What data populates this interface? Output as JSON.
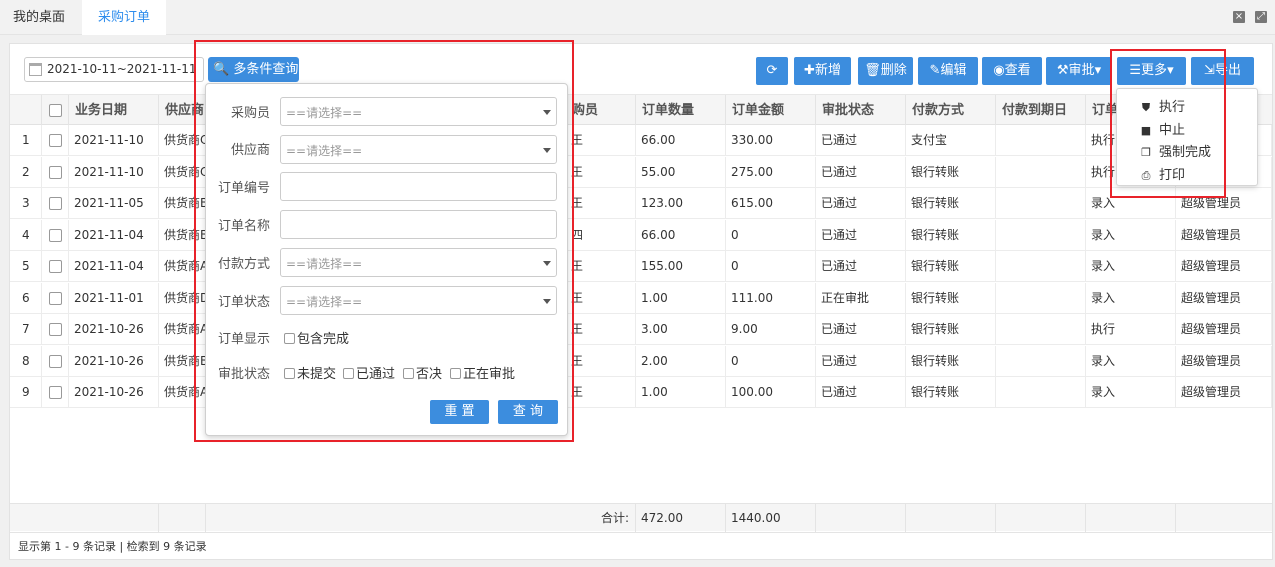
{
  "tabs": [
    {
      "label": "我的桌面"
    },
    {
      "label": "采购订单"
    }
  ],
  "toolbar": {
    "date_range": "2021-10-11~2021-11-11",
    "query_label": "多条件查询",
    "refresh_icon": "refresh-icon",
    "add_label": "新增",
    "delete_label": "删除",
    "edit_label": "编辑",
    "view_label": "查看",
    "approve_label": "审批",
    "more_label": "更多",
    "export_label": "导出"
  },
  "table": {
    "headers": [
      "业务日期",
      "供应商",
      "购员",
      "订单数量",
      "订单金额",
      "审批状态",
      "付款方式",
      "付款到期日",
      "订单"
    ],
    "rows": [
      {
        "no": "1",
        "date": "2021-11-10",
        "supplier": "供货商C",
        "buyer": "王",
        "qty": "66.00",
        "amount": "330.00",
        "approval": "已通过",
        "pay": "支付宝",
        "due": "",
        "status": "执行",
        "creator": ""
      },
      {
        "no": "2",
        "date": "2021-11-10",
        "supplier": "供货商C",
        "buyer": "王",
        "qty": "55.00",
        "amount": "275.00",
        "approval": "已通过",
        "pay": "银行转账",
        "due": "",
        "status": "执行",
        "creator": ""
      },
      {
        "no": "3",
        "date": "2021-11-05",
        "supplier": "供货商B",
        "buyer": "王",
        "qty": "123.00",
        "amount": "615.00",
        "approval": "已通过",
        "pay": "银行转账",
        "due": "",
        "status": "录入",
        "creator": "超级管理员"
      },
      {
        "no": "4",
        "date": "2021-11-04",
        "supplier": "供货商B",
        "buyer": "四",
        "qty": "66.00",
        "amount": "0",
        "approval": "已通过",
        "pay": "银行转账",
        "due": "",
        "status": "录入",
        "creator": "超级管理员"
      },
      {
        "no": "5",
        "date": "2021-11-04",
        "supplier": "供货商A",
        "buyer": "王",
        "qty": "155.00",
        "amount": "0",
        "approval": "已通过",
        "pay": "银行转账",
        "due": "",
        "status": "录入",
        "creator": "超级管理员"
      },
      {
        "no": "6",
        "date": "2021-11-01",
        "supplier": "供货商D",
        "buyer": "王",
        "qty": "1.00",
        "amount": "111.00",
        "approval": "正在审批",
        "pay": "银行转账",
        "due": "",
        "status": "录入",
        "creator": "超级管理员"
      },
      {
        "no": "7",
        "date": "2021-10-26",
        "supplier": "供货商A",
        "buyer": "王",
        "qty": "3.00",
        "amount": "9.00",
        "approval": "已通过",
        "pay": "银行转账",
        "due": "",
        "status": "执行",
        "creator": "超级管理员"
      },
      {
        "no": "8",
        "date": "2021-10-26",
        "supplier": "供货商B",
        "buyer": "王",
        "qty": "2.00",
        "amount": "0",
        "approval": "已通过",
        "pay": "银行转账",
        "due": "",
        "status": "录入",
        "creator": "超级管理员"
      },
      {
        "no": "9",
        "date": "2021-10-26",
        "supplier": "供货商A",
        "buyer": "王",
        "qty": "1.00",
        "amount": "100.00",
        "approval": "已通过",
        "pay": "银行转账",
        "due": "",
        "status": "录入",
        "creator": "超级管理员"
      }
    ],
    "total_label": "合计:",
    "total_qty": "472.00",
    "total_amount": "1440.00"
  },
  "pager": {
    "text": "显示第 1 - 9 条记录 | 检索到 9 条记录"
  },
  "query_panel": {
    "buyer_label": "采购员",
    "supplier_label": "供应商",
    "order_no_label": "订单编号",
    "order_name_label": "订单名称",
    "pay_method_label": "付款方式",
    "order_status_label": "订单状态",
    "order_display_label": "订单显示",
    "approval_status_label": "审批状态",
    "select_placeholder": "==请选择==",
    "include_done": "包含完成",
    "approval_options": [
      "未提交",
      "已通过",
      "否决",
      "正在审批"
    ],
    "reset_label": "重 置",
    "search_label": "查 询"
  },
  "more_menu": {
    "items": [
      {
        "label": "执行",
        "icon": "shield-icon"
      },
      {
        "label": "中止",
        "icon": "stop-icon"
      },
      {
        "label": "强制完成",
        "icon": "copy-icon"
      },
      {
        "label": "打印",
        "icon": "print-icon"
      }
    ]
  },
  "colors": {
    "primary": "#3c8dde",
    "highlight": "#e8222a"
  }
}
